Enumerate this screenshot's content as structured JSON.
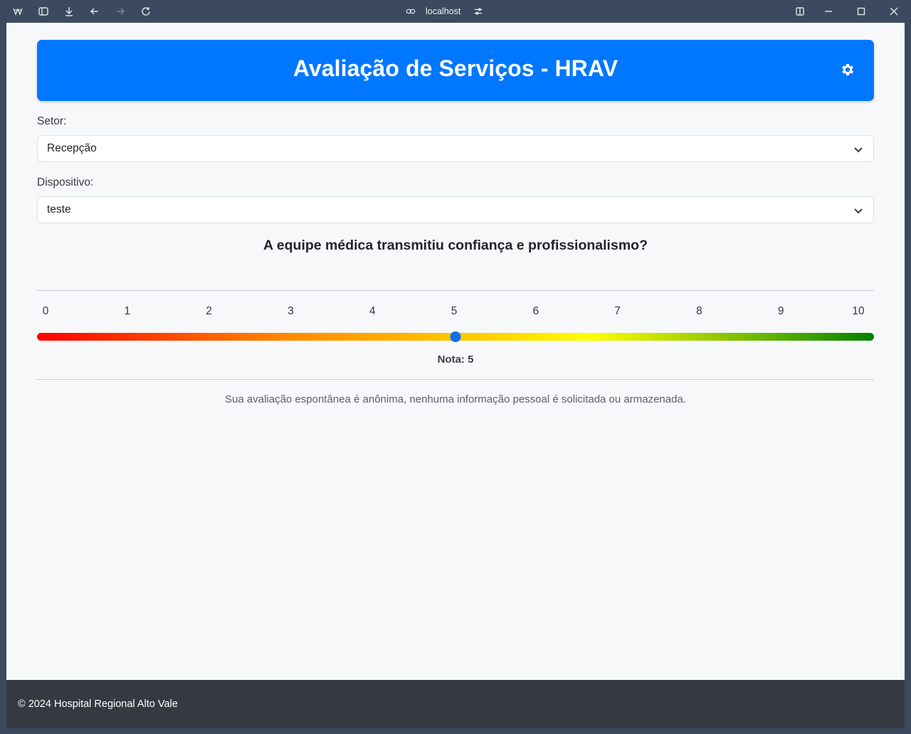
{
  "browser": {
    "url": "localhost",
    "icons": [
      "app-logo-icon",
      "sidebar-toggle-icon",
      "download-icon",
      "back-icon",
      "forward-icon",
      "reload-icon",
      "link-icon",
      "site-settings-icon",
      "split-view-icon",
      "minimize-icon",
      "maximize-icon",
      "close-icon"
    ]
  },
  "header": {
    "title": "Avaliação de Serviços - HRAV",
    "accent_color": "#0077ff"
  },
  "form": {
    "sector_label": "Setor:",
    "sector_value": "Recepção",
    "device_label": "Dispositivo:",
    "device_value": "teste"
  },
  "rating": {
    "question": "A equipe médica transmitiu confiança e profissionalismo?",
    "ticks": [
      "0",
      "1",
      "2",
      "3",
      "4",
      "5",
      "6",
      "7",
      "8",
      "9",
      "10"
    ],
    "min": 0,
    "max": 10,
    "value": 5,
    "score_text": "Nota: 5",
    "gradient_colors": [
      "#ff0000",
      "#ff8a00",
      "#ffd400",
      "#ffff00",
      "#5fb000",
      "#008000"
    ]
  },
  "privacy_note": "Sua avaliação espontânea é anônima, nenhuma informação pessoal é solicitada ou armazenada.",
  "footer": {
    "text": "© 2024 Hospital Regional Alto Vale"
  }
}
